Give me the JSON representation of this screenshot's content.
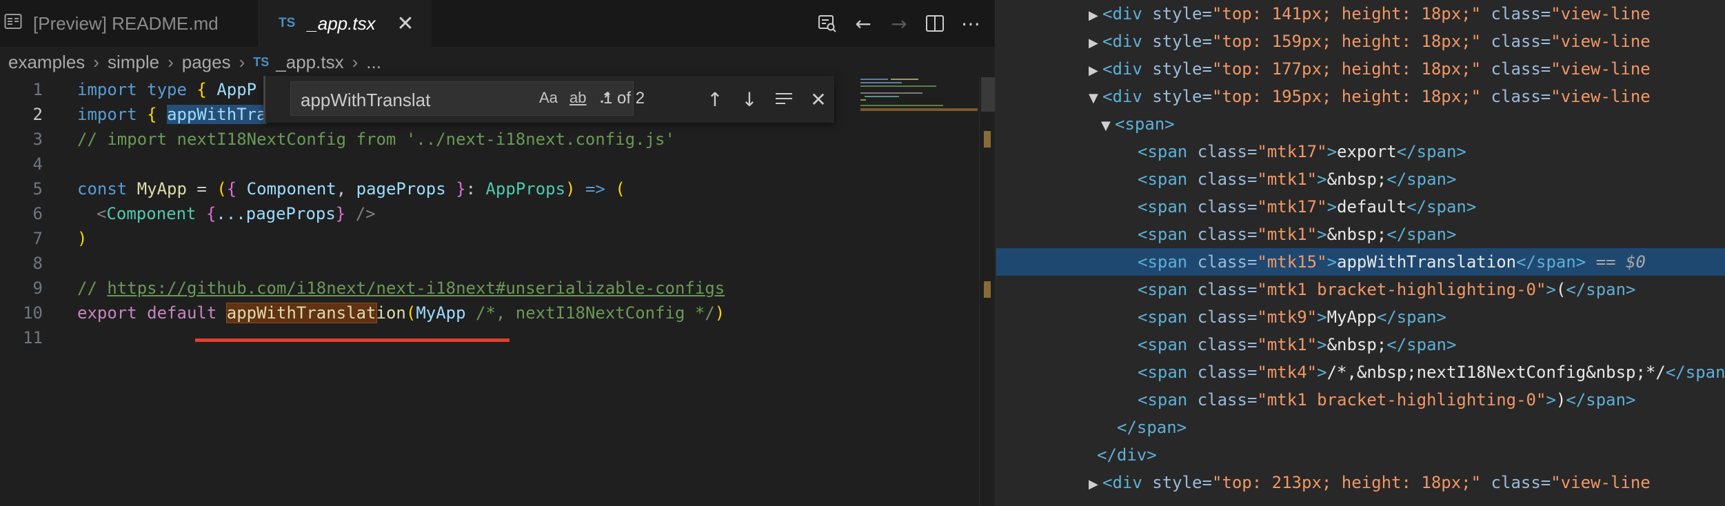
{
  "editor": {
    "tabs": [
      {
        "label": "[Preview] README.md",
        "icon": "preview-icon"
      },
      {
        "label": "_app.tsx",
        "icon": "typescript-file-icon",
        "badge": "TS"
      }
    ],
    "actions": [
      "open-changes-icon",
      "arrow-left-icon",
      "arrow-right-icon",
      "split-editor-icon",
      "more-icon"
    ],
    "breadcrumb": [
      "examples",
      "simple",
      "pages",
      "_app.tsx",
      "..."
    ],
    "breadcrumb_badge": "TS",
    "line_numbers": [
      "1",
      "2",
      "3",
      "4",
      "5",
      "6",
      "7",
      "8",
      "9",
      "10",
      "11"
    ],
    "active_line": "2",
    "find": {
      "value": "appWithTranslat",
      "opt_case": "Aa",
      "opt_word": "ab",
      "opt_regex": ".*",
      "count": "1 of 2"
    },
    "code": {
      "l1_import": "import",
      "l1_type": "type",
      "l1_open": "{",
      "l1_name": "AppP",
      "l2_import": "import",
      "l2_open": "{",
      "l2_name": "appWithTra",
      "l3": "// import nextI18NextConfig from '../next-i18next.config.js'",
      "l5_const": "const",
      "l5_name": "MyApp",
      "l5_eq": " = ",
      "l5_p1": "(",
      "l5_b1": "{",
      "l5_comp": " Component",
      "l5_comma": ", ",
      "l5_pp": "pageProps",
      "l5_b2": " }",
      "l5_colon": ": ",
      "l5_type": "AppProps",
      "l5_p2": ")",
      "l5_arrow": " => ",
      "l5_p3": "(",
      "l6_lt": "<",
      "l6_comp": "Component",
      "l6_b1": " {",
      "l6_spread": "...pageProps",
      "l6_b2": "}",
      "l6_end": " />",
      "l7": ")",
      "l9_prefix": "// ",
      "l9_url": "https://github.com/i18next/next-i18next#unserializable-configs",
      "l10_export": "export",
      "l10_default": " default ",
      "l10_match": "appWithTranslat",
      "l10_rest": "ion",
      "l10_p1": "(",
      "l10_arg": "MyApp",
      "l10_cm": " /*, nextI18NextConfig */",
      "l10_p2": ")"
    }
  },
  "devtools": {
    "lines": [
      {
        "tag": "<div",
        "attr1": "style",
        "val1": "\"top: 141px; height: 18px;\"",
        "attr2": "class",
        "val2": "\"view-line"
      },
      {
        "tag": "<div",
        "attr1": "style",
        "val1": "\"top: 159px; height: 18px;\"",
        "attr2": "class",
        "val2": "\"view-line"
      },
      {
        "tag": "<div",
        "attr1": "style",
        "val1": "\"top: 177px; height: 18px;\"",
        "attr2": "class",
        "val2": "\"view-line"
      },
      {
        "tag": "<div",
        "attr1": "style",
        "val1": "\"top: 195px; height: 18px;\"",
        "attr2": "class",
        "val2": "\"view-line"
      }
    ],
    "span_open": "<span>",
    "spans": [
      {
        "cls": "\"mtk17\"",
        "text": "export"
      },
      {
        "cls": "\"mtk1\"",
        "text": "&nbsp;"
      },
      {
        "cls": "\"mtk17\"",
        "text": "default"
      },
      {
        "cls": "\"mtk1\"",
        "text": "&nbsp;"
      },
      {
        "cls": "\"mtk15\"",
        "text": "appWithTranslation"
      },
      {
        "cls": "\"mtk1 bracket-highlighting-0\"",
        "text": "("
      },
      {
        "cls": "\"mtk9\"",
        "text": "MyApp"
      },
      {
        "cls": "\"mtk1\"",
        "text": "&nbsp;"
      },
      {
        "cls": "\"mtk4\"",
        "text": "/*,&nbsp;nextI18NextConfig&nbsp;*/"
      },
      {
        "cls": "\"mtk1 bracket-highlighting-0\"",
        "text": ")"
      }
    ],
    "span_tag_open": "<span",
    "class_attr": "class",
    "span_tag_close": "</span>",
    "selected_suffix": "== $0",
    "span_close": "</span>",
    "div_close": "</div>",
    "last_line": {
      "tag": "<div",
      "attr1": "style",
      "val1": "\"top: 213px; height: 18px;\"",
      "attr2": "class",
      "val2": "\"view-line"
    }
  }
}
